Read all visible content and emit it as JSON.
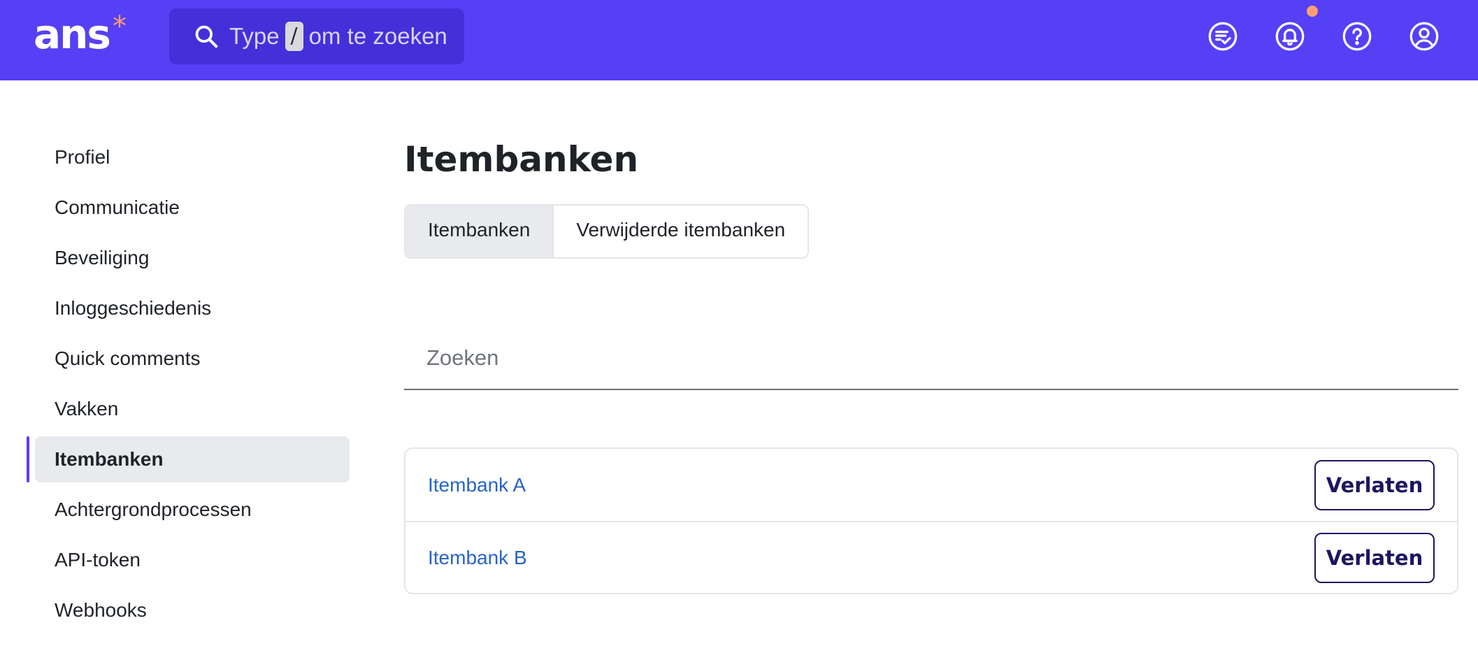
{
  "header": {
    "logo_text": "ans",
    "logo_mark": "*",
    "search": {
      "prefix": "Type",
      "shortcut_key": "/",
      "suffix": "om te zoeken"
    },
    "icons": [
      {
        "name": "task-list-icon"
      },
      {
        "name": "notifications-bell-icon",
        "has_badge": true
      },
      {
        "name": "help-question-icon"
      },
      {
        "name": "user-account-icon"
      }
    ],
    "colors": {
      "background": "#5540f6",
      "accent": "#ff9d73"
    }
  },
  "sidebar": {
    "items": [
      {
        "label": "Profiel",
        "active": false
      },
      {
        "label": "Communicatie",
        "active": false
      },
      {
        "label": "Beveiliging",
        "active": false
      },
      {
        "label": "Inloggeschiedenis",
        "active": false
      },
      {
        "label": "Quick comments",
        "active": false
      },
      {
        "label": "Vakken",
        "active": false
      },
      {
        "label": "Itembanken",
        "active": true
      },
      {
        "label": "Achtergrondprocessen",
        "active": false
      },
      {
        "label": "API-token",
        "active": false
      },
      {
        "label": "Webhooks",
        "active": false
      }
    ]
  },
  "main": {
    "title": "Itembanken",
    "tabs": [
      {
        "label": "Itembanken",
        "active": true
      },
      {
        "label": "Verwijderde itembanken",
        "active": false
      }
    ],
    "search": {
      "placeholder": "Zoeken",
      "value": ""
    },
    "rows": [
      {
        "name": "Itembank A",
        "action": "Verlaten"
      },
      {
        "name": "Itembank B",
        "action": "Verlaten"
      }
    ]
  }
}
